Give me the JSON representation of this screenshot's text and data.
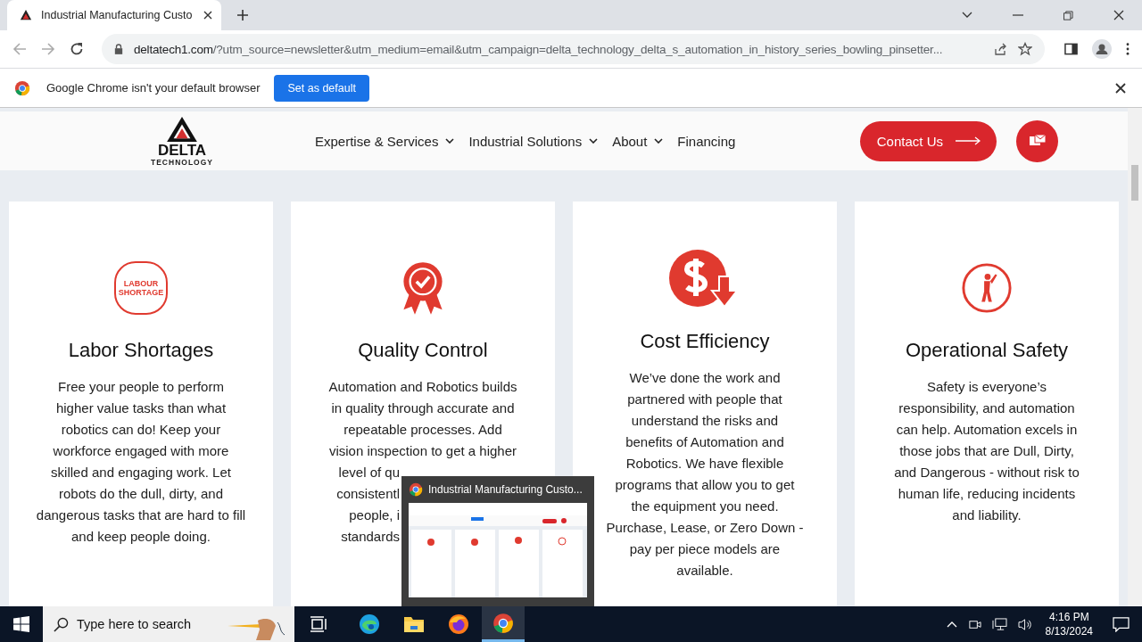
{
  "browser": {
    "tab": {
      "title": "Industrial Manufacturing Custo",
      "selected": true
    },
    "url": {
      "host": "deltatech1.com",
      "path": "/?utm_source=newsletter&utm_medium=email&utm_campaign=delta_technology_delta_s_automation_in_history_series_bowling_pinsetter..."
    },
    "infobar": {
      "message": "Google Chrome isn't your default browser",
      "button": "Set as default"
    }
  },
  "site": {
    "logo": {
      "name": "DELTA",
      "tagline": "TECHNOLOGY"
    },
    "nav": [
      {
        "label": "Expertise & Services",
        "dropdown": true
      },
      {
        "label": "Industrial Solutions",
        "dropdown": true
      },
      {
        "label": "About",
        "dropdown": true
      },
      {
        "label": "Financing",
        "dropdown": false
      }
    ],
    "contact_button": "Contact Us"
  },
  "cards": [
    {
      "kind": "badge",
      "badge_text": [
        "LABOUR",
        "SHORTAGE"
      ],
      "title": "Labor Shortages",
      "lines": [
        "Free your people to perform",
        "higher value tasks than what",
        "robotics can do! Keep your",
        "workforce engaged with more",
        "skilled and engaging work. Let",
        "robots do the dull, dirty, and",
        "dangerous tasks that are hard to fill",
        "and keep people doing."
      ]
    },
    {
      "kind": "ribbon",
      "title": "Quality Control",
      "lines": [
        "Automation and Robotics builds",
        "in quality through accurate and",
        "repeatable processes. Add",
        "vision inspection to get a higher"
      ],
      "cut_lines": [
        "level of qu",
        "consistentl",
        "people, i",
        "standards"
      ]
    },
    {
      "kind": "dollar",
      "title": "Cost Efficiency",
      "lines": [
        "We’ve done the work and",
        "partnered with people that",
        "understand the risks and",
        "benefits of Automation and",
        "Robotics. We have flexible",
        "programs that allow you to get",
        "the equipment you need.",
        "Purchase, Lease, or Zero Down -",
        "pay per piece models are",
        "available."
      ]
    },
    {
      "kind": "person",
      "title": "Operational Safety",
      "lines": [
        "Safety is everyone’s",
        "responsibility, and automation",
        "can help. Automation excels in",
        "those jobs that are Dull, Dirty,",
        "and Dangerous - without risk to",
        "human life, reducing incidents",
        "and liability."
      ]
    }
  ],
  "taskbar_preview": {
    "title": "Industrial Manufacturing Custo..."
  },
  "taskbar": {
    "search_placeholder": "Type here to search",
    "apps": [
      {
        "kind": "edge",
        "selected": false
      },
      {
        "kind": "folder",
        "selected": false
      },
      {
        "kind": "firefox",
        "selected": false
      },
      {
        "kind": "chrome",
        "selected": true
      }
    ],
    "time": "4:16 PM",
    "date": "8/13/2024"
  }
}
